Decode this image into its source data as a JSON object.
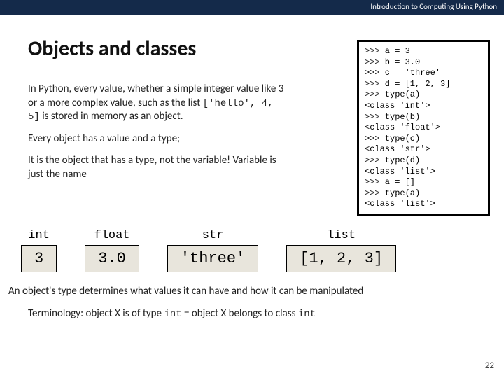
{
  "header": {
    "course": "Introduction to Computing Using Python"
  },
  "title": "Objects and classes",
  "para1_a": "In Python, every value, whether a simple integer value like 3 or a more complex value, such as the list ",
  "para1_code": "['hello', 4,  5]",
  "para1_b": " is stored in memory as an object.",
  "para2": "Every object has a value and a type;",
  "para3": "It is the object that has a type, not the variable! Variable is just the name",
  "terminal": ">>> a = 3\n>>> b = 3.0\n>>> c = 'three'\n>>> d = [1, 2, 3]\n>>> type(a)\n<class 'int'>\n>>> type(b)\n<class 'float'>\n>>> type(c)\n<class 'str'>\n>>> type(d)\n<class 'list'>\n>>> a = []\n>>> type(a)\n<class 'list'>",
  "types": [
    {
      "label": "int",
      "value": "3"
    },
    {
      "label": "float",
      "value": "3.0"
    },
    {
      "label": "str",
      "value": "'three'"
    },
    {
      "label": "list",
      "value": "[1, 2, 3]"
    }
  ],
  "footer": "An object's type determines what values it can have and how it can be manipulated",
  "term_a": "Terminology: object X is of type ",
  "term_code1": "int",
  "term_b": " = object X belongs to class ",
  "term_code2": "int",
  "pagenum": "22"
}
